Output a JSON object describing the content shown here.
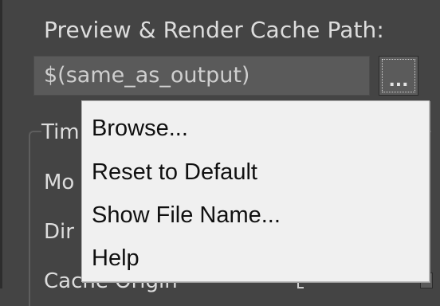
{
  "panel": {
    "title": "Preview & Render Cache Path:",
    "path_value": "$(same_as_output)",
    "browse_button_label": "...",
    "group_title": "Tim",
    "rows": [
      "Mo",
      "Dir",
      "Cache Origin"
    ]
  },
  "context_menu": {
    "items": [
      "Browse...",
      "Reset to Default",
      "Show File Name...",
      "Help"
    ]
  },
  "colors": {
    "panel_bg": "#444444",
    "input_bg": "#5a5a5a",
    "menu_bg": "#f0f0f0",
    "text_light": "#dddddd",
    "text_dark": "#101010"
  }
}
